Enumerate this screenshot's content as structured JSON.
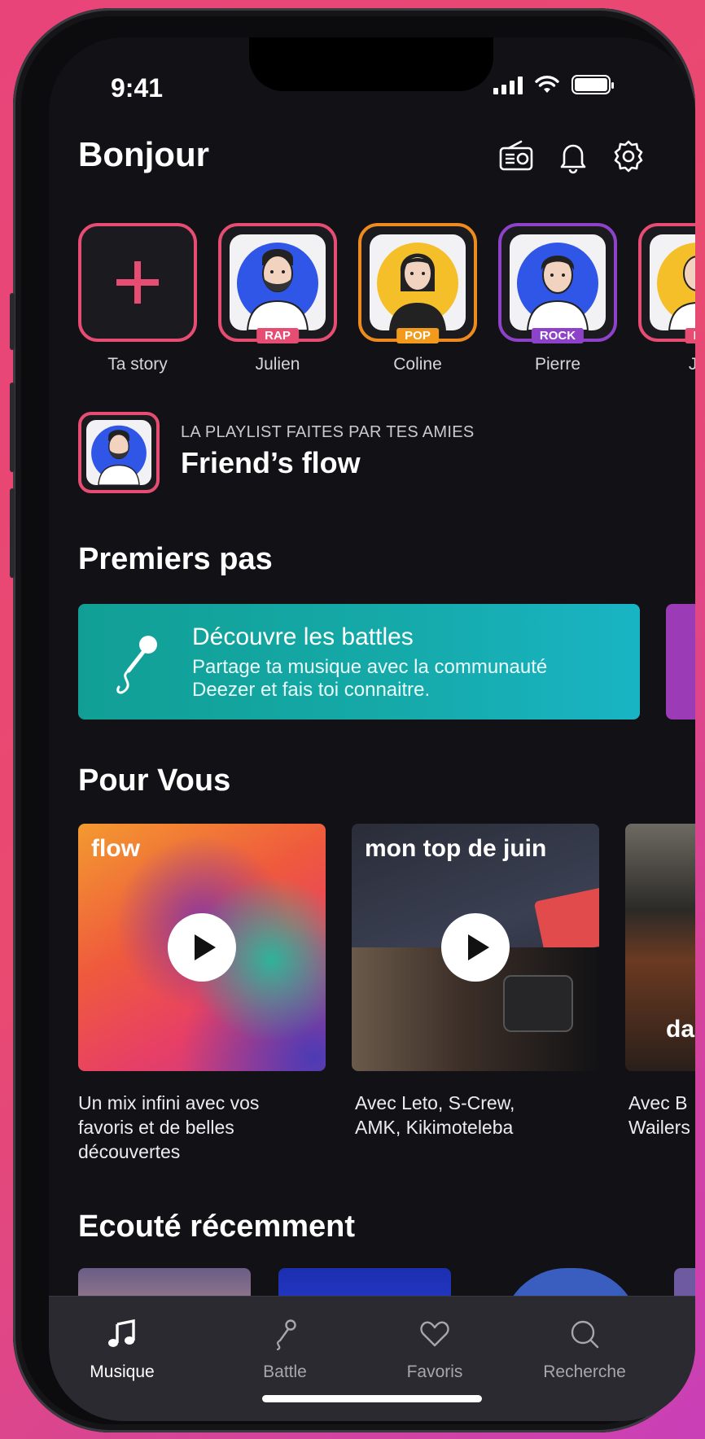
{
  "status": {
    "time": "9:41"
  },
  "header": {
    "greeting": "Bonjour"
  },
  "stories": [
    {
      "name": "Ta story",
      "tag": null,
      "border": "#e74d72"
    },
    {
      "name": "Julien",
      "tag": "RAP",
      "border": "#e74d72",
      "tag_color": "#e74d72",
      "avatar_bg": "#2f56e6"
    },
    {
      "name": "Coline",
      "tag": "POP",
      "border": "#ef8a1e",
      "tag_color": "#f29a1b",
      "avatar_bg": "#f5bf2a"
    },
    {
      "name": "Pierre",
      "tag": "ROCK",
      "border": "#8d42c9",
      "tag_color": "#8d42c9",
      "avatar_bg": "#2f56e6"
    },
    {
      "name": "Ju",
      "tag": "R",
      "border": "#e74d72",
      "tag_color": "#e74d72",
      "avatar_bg": "#f5bf2a"
    }
  ],
  "friends_flow": {
    "kicker": "LA PLAYLIST FAITES PAR TES AMIES",
    "title": "Friend’s flow"
  },
  "sections": {
    "premiers_pas": "Premiers pas",
    "pour_vous": "Pour Vous",
    "ecoute": "Ecouté récemment"
  },
  "battle_card": {
    "title": "Découvre les battles",
    "desc1": "Partage ta musique avec la communauté",
    "desc2": "Deezer et fais toi connaitre."
  },
  "pour_vous": [
    {
      "title": "flow",
      "caption": [
        "Un mix infini avec vos",
        "favoris et de belles",
        "découvertes"
      ]
    },
    {
      "title": "mon top de juin",
      "caption": [
        "Avec Leto, S-Crew,",
        "AMK, Kikimoteleba"
      ]
    },
    {
      "title": "da",
      "caption": [
        "Avec B",
        "Wailers"
      ]
    }
  ],
  "tabs": [
    {
      "label": "Musique",
      "icon": "music-note-icon",
      "active": true
    },
    {
      "label": "Battle",
      "icon": "microphone-icon",
      "active": false
    },
    {
      "label": "Favoris",
      "icon": "heart-icon",
      "active": false
    },
    {
      "label": "Recherche",
      "icon": "search-icon",
      "active": false
    }
  ],
  "colors": {
    "accent": "#e74d72",
    "background": "#121216",
    "battle_card": "#15a9a8"
  }
}
